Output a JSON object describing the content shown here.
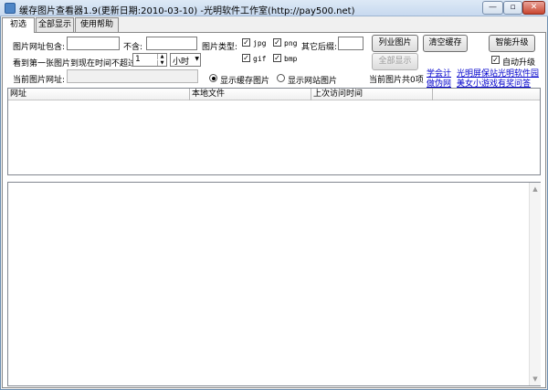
{
  "window": {
    "title": "缓存图片查看器1.9(更新日期:2010-03-10) -光明软件工作室(http://pay500.net)",
    "min_glyph": "—",
    "max_glyph": "▫",
    "close_glyph": "✕"
  },
  "tabs": [
    {
      "label": "初选",
      "selected": true
    },
    {
      "label": "全部显示",
      "selected": false
    },
    {
      "label": "使用帮助",
      "selected": false
    }
  ],
  "filters": {
    "url_contains_label": "图片网址包含:",
    "url_contains_value": "",
    "not_contains_label": "不含:",
    "not_contains_value": "",
    "image_type_label": "图片类型:",
    "types": [
      {
        "label": "jpg",
        "checked": true
      },
      {
        "label": "png",
        "checked": true
      },
      {
        "label": "gif",
        "checked": true
      },
      {
        "label": "bmp",
        "checked": true
      }
    ],
    "other_ext_label": "其它后缀:",
    "other_ext_value": "",
    "time_limit_label": "看到第一张图片到现在时间不超过:",
    "time_value": "1",
    "time_unit": "小时",
    "current_url_label": "当前图片网址:",
    "current_url_value": "",
    "radio_cache": "显示缓存图片",
    "radio_web": "显示网站图片",
    "radio_selected": "cache"
  },
  "buttons": {
    "list_images": "列业图片",
    "clear_cache": "清空缓存",
    "smart_upgrade": "智能升级",
    "show_all": "全部显示",
    "auto_upgrade": "自动升级",
    "auto_upgrade_checked": true
  },
  "status": {
    "count_text": "当前图片共0项"
  },
  "links": [
    "学会计",
    "光明屏保站",
    "光明软件园",
    "做伪网",
    "美女小游戏",
    "有奖问答"
  ],
  "list": {
    "columns": [
      "网址",
      "本地文件",
      "上次访问时间"
    ]
  },
  "icons": {
    "check": "✓",
    "spin_up": "▲",
    "spin_down": "▼",
    "dropdown": "▼",
    "scroll_up": "▲",
    "scroll_down": "▼"
  }
}
